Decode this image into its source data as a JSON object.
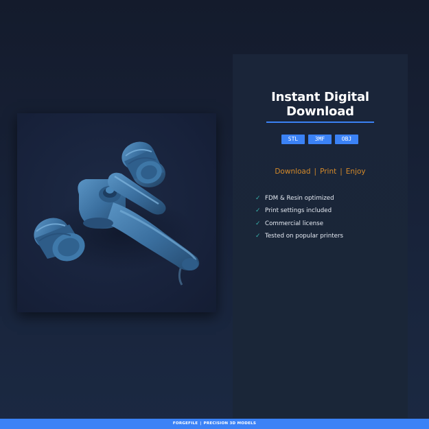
{
  "product_image": {
    "subject": "blue-faucet-model"
  },
  "panel": {
    "title_line1": "Instant Digital",
    "title_line2": "Download",
    "formats": [
      "STL",
      "3MF",
      "OBJ"
    ],
    "actions": [
      "Download",
      "Print",
      "Enjoy"
    ],
    "action_separator": "|",
    "check_glyph": "✓",
    "features": [
      "FDM & Resin optimized",
      "Print settings included",
      "Commercial license",
      "Tested on popular printers"
    ]
  },
  "footer": {
    "brand": "FORGEFILE",
    "separator": "|",
    "tagline": "PRECISION 3D MODELS"
  },
  "colors": {
    "accent_blue": "#3b82f6",
    "action_orange": "#d58a2a",
    "check_teal": "#38b2ac",
    "model_blue": "#3f76a3"
  }
}
